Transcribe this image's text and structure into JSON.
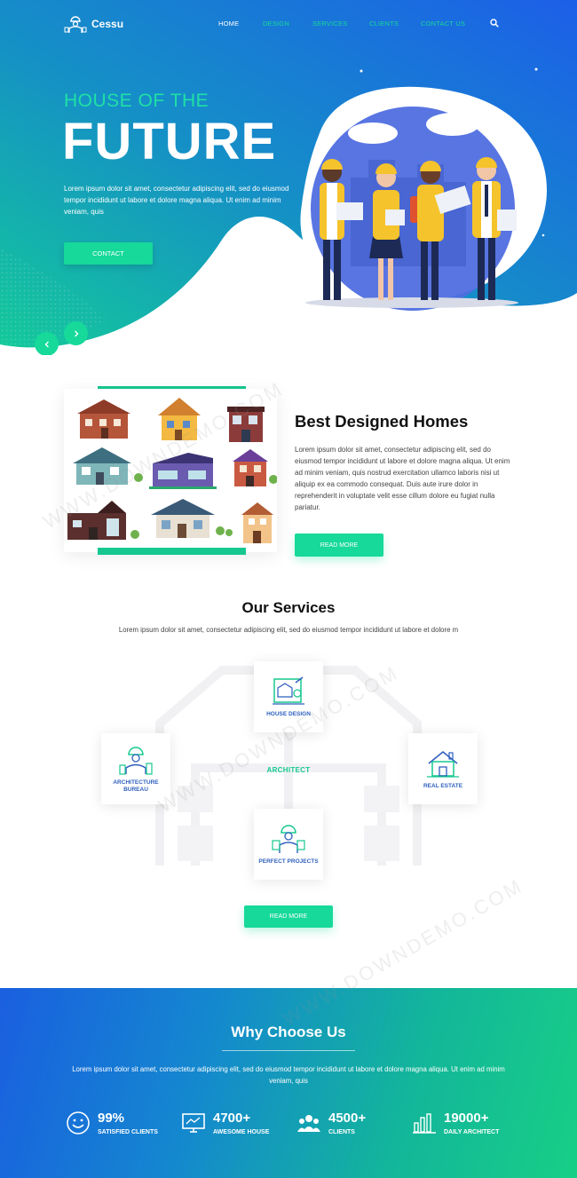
{
  "brand": {
    "name": "Cessu"
  },
  "nav": {
    "items": [
      {
        "label": "HOME",
        "active": true
      },
      {
        "label": "DESIGN",
        "active": false
      },
      {
        "label": "SERVICES",
        "active": false
      },
      {
        "label": "CLIENTS",
        "active": false
      },
      {
        "label": "CONTACT US",
        "active": false
      }
    ],
    "search_icon": "search-icon"
  },
  "hero": {
    "subtitle": "HOUSE OF THE",
    "title": "FUTURE",
    "text": "Lorem ipsum dolor sit amet, consectetur adipiscing elit, sed do eiusmod tempor incididunt ut labore et dolore magna aliqua. Ut enim ad minim veniam, quis",
    "contact_label": "CONTACT"
  },
  "homes": {
    "title": "Best Designed Homes",
    "text": "Lorem ipsum dolor sit amet, consectetur adipiscing elit, sed do eiusmod tempor incididunt ut labore et dolore magna aliqua. Ut enim ad minim veniam, quis nostrud exercitation ullamco laboris nisi ut aliquip ex ea commodo consequat. Duis aute irure dolor in reprehenderit in voluptate velit esse cillum dolore eu fugiat nulla pariatur.",
    "read_more_label": "READ MORE"
  },
  "services": {
    "title": "Our Services",
    "text": "Lorem ipsum dolor sit amet, consectetur adipiscing elit, sed do eiusmod tempor incididunt ut labore et dolore m",
    "center_label": "ARCHITECT",
    "cards": [
      {
        "label": "HOUSE DESIGN",
        "icon": "blueprint-icon"
      },
      {
        "label": "ARCHITECTURE BUREAU",
        "icon": "architect-worker-icon"
      },
      {
        "label": "REAL ESTATE",
        "icon": "house-icon"
      },
      {
        "label": "PERFECT PROJECTS",
        "icon": "engineer-icon"
      }
    ],
    "read_more_label": "READ MORE"
  },
  "why": {
    "title": "Why Choose Us",
    "text": "Lorem ipsum dolor sit amet, consectetur adipiscing elit, sed do eiusmod tempor incididunt ut labore et dolore magna aliqua. Ut enim ad minim veniam, quis",
    "stats": [
      {
        "value": "99%",
        "label": "SATISFIED CLIENTS",
        "icon": "smiley-icon"
      },
      {
        "value": "4700+",
        "label": "AWESOME HOUSE",
        "icon": "monitor-icon"
      },
      {
        "value": "4500+",
        "label": "CLIENTS",
        "icon": "people-icon"
      },
      {
        "value": "19000+",
        "label": "DAILY ARCHITECT",
        "icon": "bar-chart-icon"
      }
    ]
  },
  "watermark": "WWW.DOWNDEMO.COM",
  "colors": {
    "accent": "#16d99a",
    "blue": "#1a5fe0",
    "service_label": "#2e5fbe"
  }
}
